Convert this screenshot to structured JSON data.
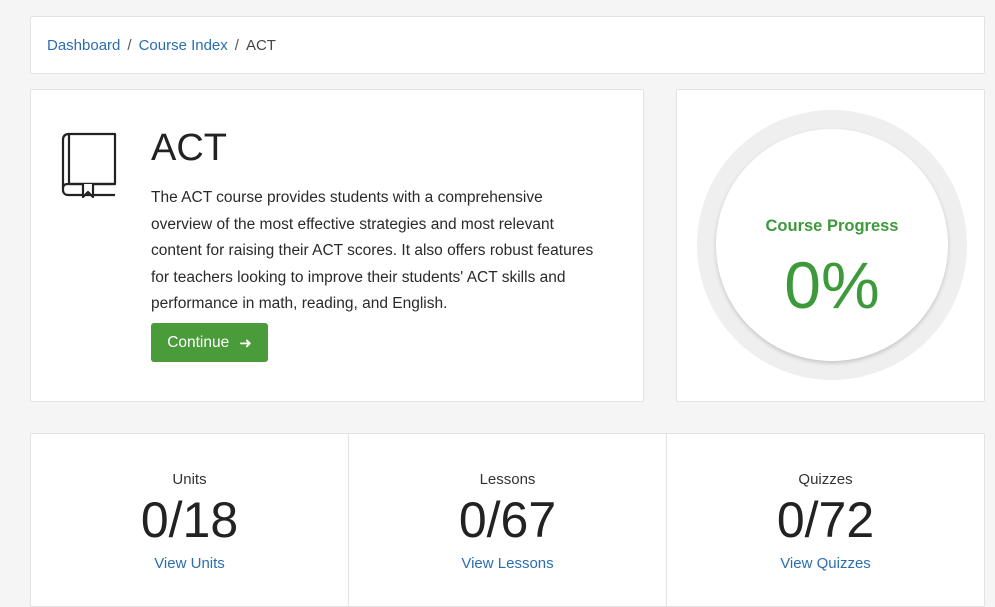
{
  "breadcrumb": {
    "items": [
      "Dashboard",
      "Course Index"
    ],
    "separator": "/",
    "current": "ACT"
  },
  "course": {
    "icon": "book-icon",
    "title": "ACT",
    "description": "The ACT course provides students with a comprehensive overview of the most effective strategies and most relevant content for raising their ACT scores. It also offers robust features for teachers looking to improve their students' ACT skills and performance in math, reading, and English.",
    "continue_label": "Continue",
    "continue_icon": "arrow-right-icon"
  },
  "progress": {
    "label": "Course Progress",
    "value": "0%",
    "color": "#3c9a3a"
  },
  "stats": [
    {
      "label": "Units",
      "value": "0/18",
      "link": "View Units"
    },
    {
      "label": "Lessons",
      "value": "0/67",
      "link": "View Lessons"
    },
    {
      "label": "Quizzes",
      "value": "0/72",
      "link": "View Quizzes"
    }
  ],
  "colors": {
    "link": "#2a6eb0",
    "button": "#4a9b3a"
  }
}
